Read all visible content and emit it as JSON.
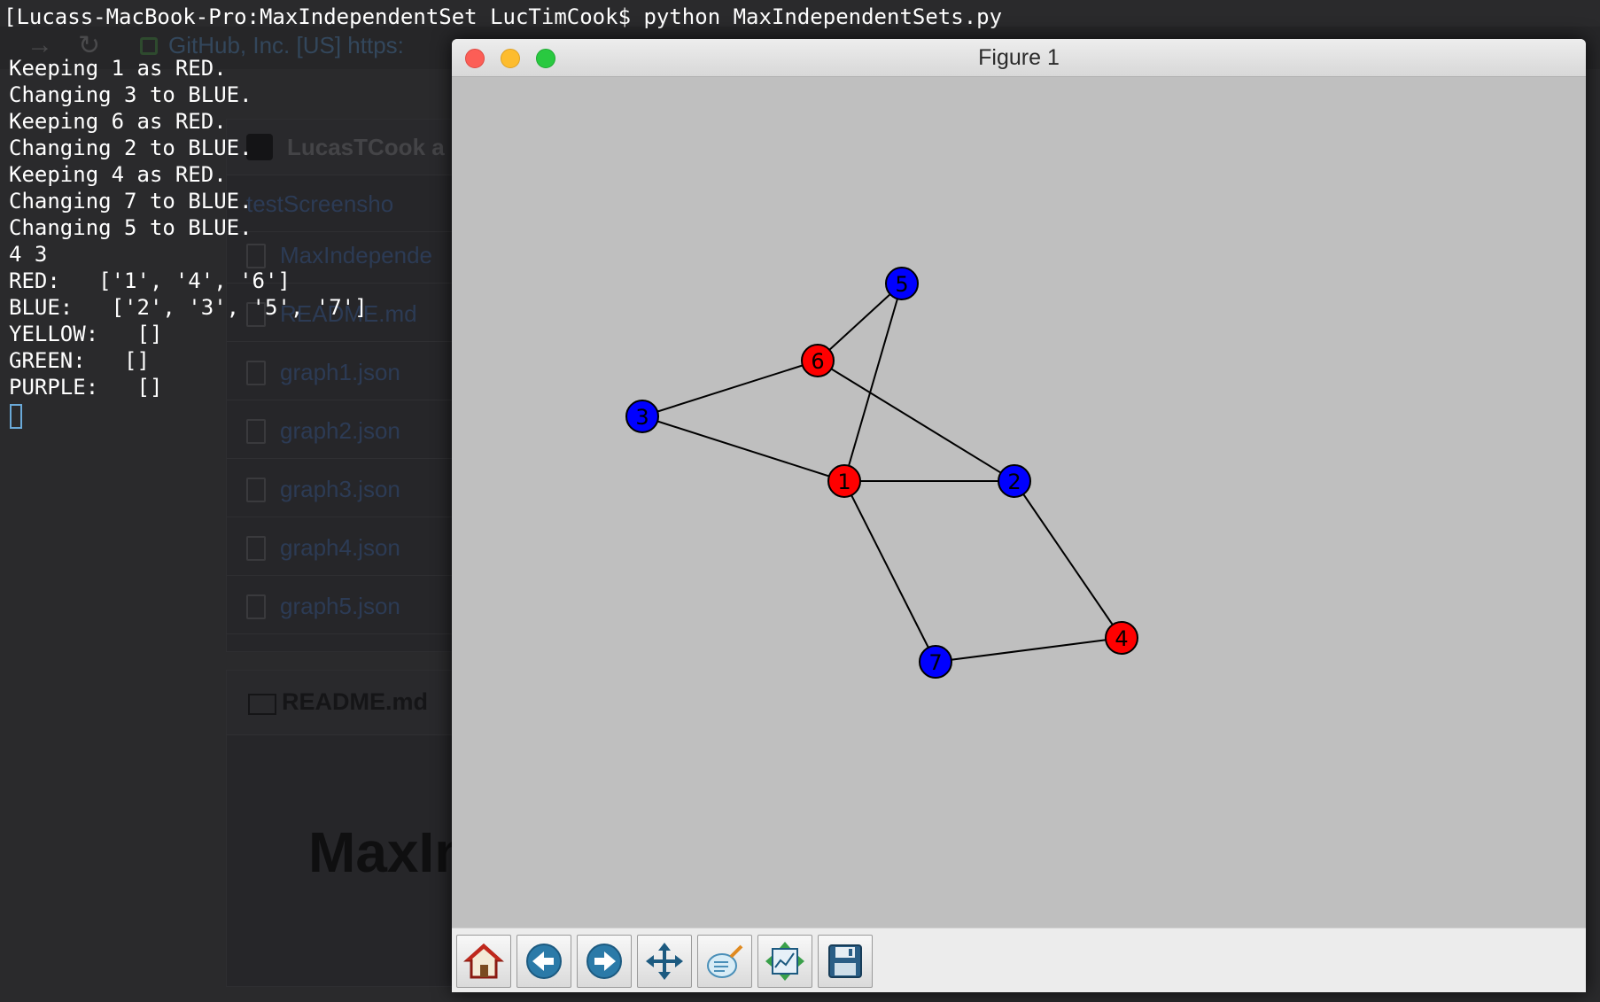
{
  "terminal": {
    "command_line": "[Lucass-MacBook-Pro:MaxIndependentSet LucTimCook$ python MaxIndependentSets.py",
    "output_lines": [
      "Keeping 1 as RED.",
      "Changing 3 to BLUE.",
      "Keeping 6 as RED.",
      "Changing 2 to BLUE.",
      "Keeping 4 as RED.",
      "Changing 7 to BLUE.",
      "Changing 5 to BLUE.",
      "4 3",
      "RED:   ['1', '4', '6']",
      "BLUE:   ['2', '3', '5', '7']",
      "YELLOW:   []",
      "GREEN:   []",
      "PURPLE:   []"
    ]
  },
  "background_browser": {
    "address": "GitHub, Inc. [US]  https:",
    "repo_header": "LucasTCook a",
    "files": [
      "testScreensho",
      "MaxIndepende",
      "README.md",
      "graph1.json",
      "graph2.json",
      "graph3.json",
      "graph4.json",
      "graph5.json"
    ],
    "readme_title": "README.md",
    "readme_heading": "MaxIn"
  },
  "figure": {
    "title": "Figure 1",
    "graph": {
      "nodes": [
        {
          "id": "1",
          "color": "#ff0000"
        },
        {
          "id": "2",
          "color": "#0000ff"
        },
        {
          "id": "3",
          "color": "#0000ff"
        },
        {
          "id": "4",
          "color": "#ff0000"
        },
        {
          "id": "5",
          "color": "#0000ff"
        },
        {
          "id": "6",
          "color": "#ff0000"
        },
        {
          "id": "7",
          "color": "#0000ff"
        }
      ],
      "edges": [
        [
          "5",
          "6"
        ],
        [
          "5",
          "1"
        ],
        [
          "6",
          "3"
        ],
        [
          "6",
          "2"
        ],
        [
          "3",
          "1"
        ],
        [
          "1",
          "2"
        ],
        [
          "1",
          "7"
        ],
        [
          "2",
          "4"
        ],
        [
          "7",
          "4"
        ]
      ]
    },
    "toolbar": [
      "home-icon",
      "back-icon",
      "forward-icon",
      "pan-icon",
      "configure-subplots-icon",
      "zoom-to-rect-icon",
      "save-icon"
    ]
  }
}
